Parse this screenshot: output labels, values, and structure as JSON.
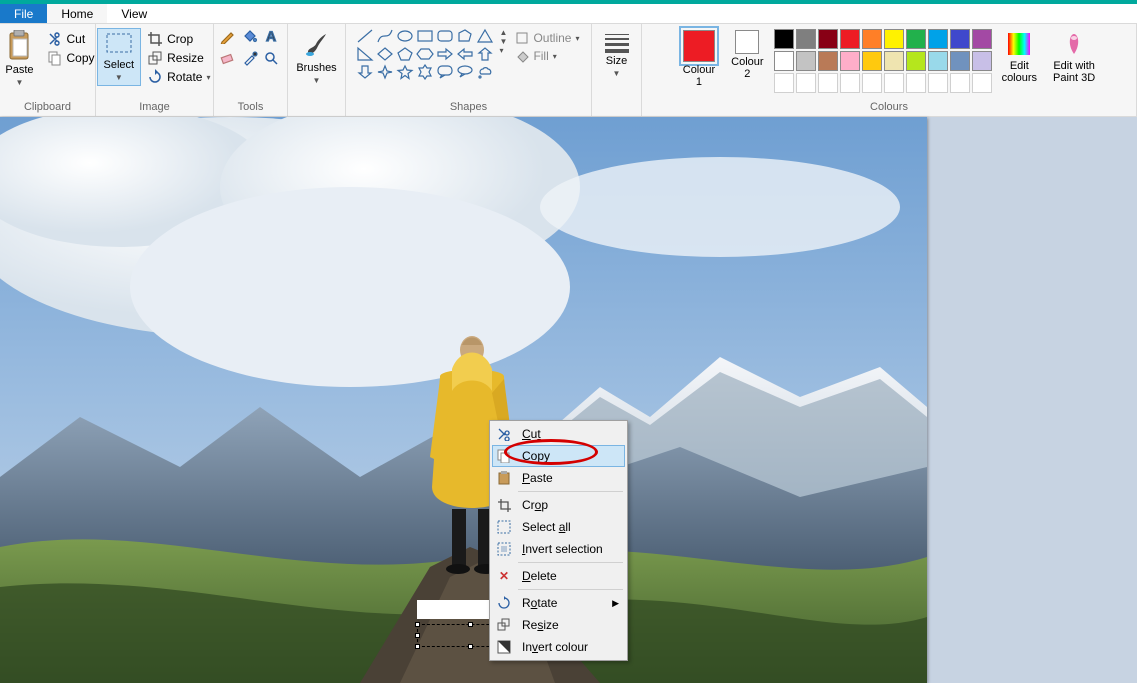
{
  "tabs": {
    "file": "File",
    "home": "Home",
    "view": "View"
  },
  "groups": {
    "clipboard": "Clipboard",
    "image": "Image",
    "tools": "Tools",
    "shapes": "Shapes",
    "size": "Size",
    "colours": "Colours"
  },
  "clipboard": {
    "paste": "Paste",
    "cut": "Cut",
    "copy": "Copy"
  },
  "image": {
    "select": "Select",
    "crop": "Crop",
    "resize": "Resize",
    "rotate": "Rotate"
  },
  "shapes_opts": {
    "outline": "Outline",
    "fill": "Fill"
  },
  "colour": {
    "c1": "Colour\n1",
    "c2": "Colour\n2",
    "edit": "Edit\ncolours",
    "edit3d": "Edit with\nPaint 3D"
  },
  "palette_row1": [
    "#000000",
    "#7f7f7f",
    "#880015",
    "#ed1c24",
    "#ff7f27",
    "#fff200",
    "#22b14c",
    "#00a2e8",
    "#3f48cc",
    "#a349a4"
  ],
  "palette_row2": [
    "#ffffff",
    "#c3c3c3",
    "#b97a57",
    "#ffaec9",
    "#ffc90e",
    "#efe4b0",
    "#b5e61d",
    "#99d9ea",
    "#7092be",
    "#c8bfe7"
  ],
  "ctx": {
    "cut": "Cut",
    "copy": "Copy",
    "paste": "Paste",
    "crop": "Crop",
    "selectall": "Select all",
    "invertsel": "Invert selection",
    "delete": "Delete",
    "rotate": "Rotate",
    "resize": "Resize",
    "invertcol": "Invert colour"
  }
}
